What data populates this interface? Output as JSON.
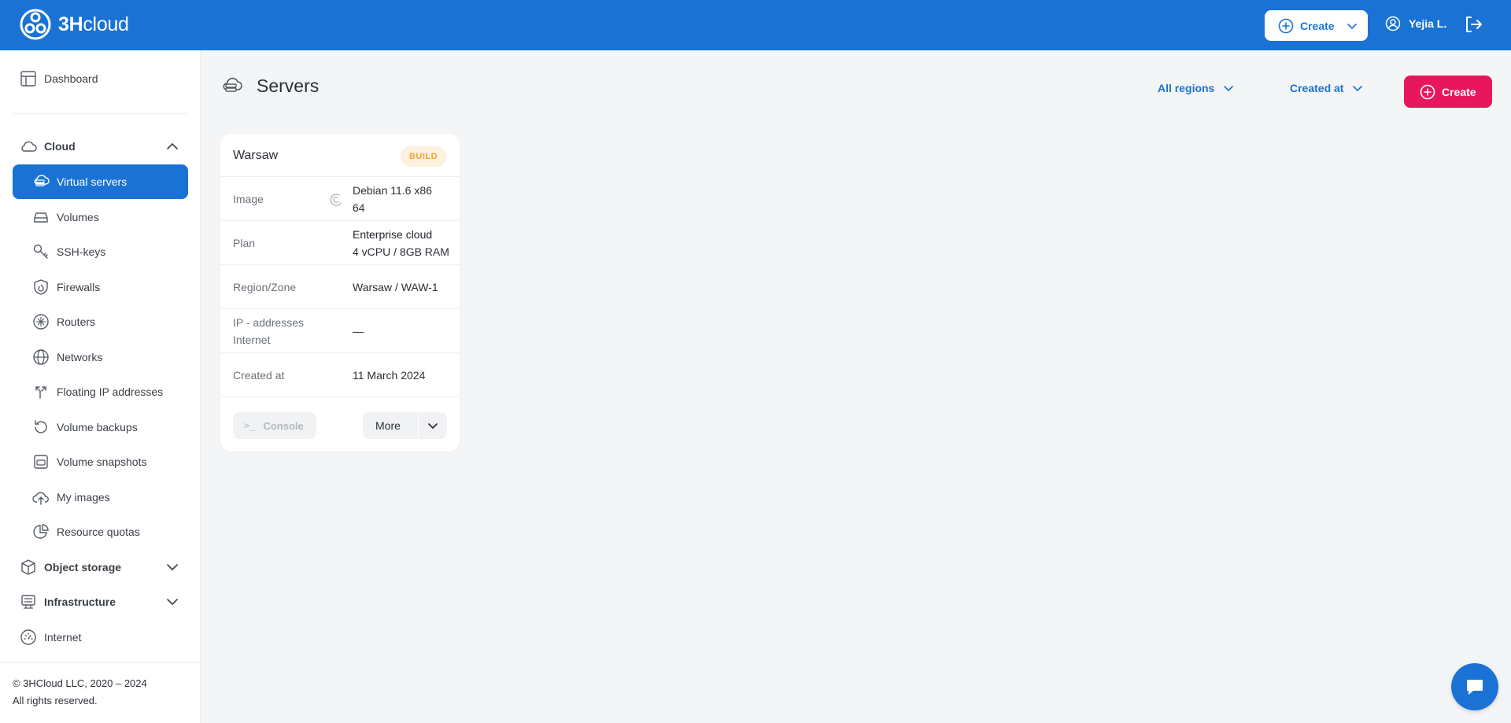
{
  "header": {
    "logo_bold": "3H",
    "logo_rest": "cloud",
    "create_label": "Create",
    "user_name": "Yejia L."
  },
  "sidebar": {
    "dashboard": "Dashboard",
    "cloud": "Cloud",
    "cloud_items": [
      {
        "label": "Virtual servers",
        "icon": "servers-icon"
      },
      {
        "label": "Volumes",
        "icon": "volume-icon"
      },
      {
        "label": "SSH-keys",
        "icon": "key-icon"
      },
      {
        "label": "Firewalls",
        "icon": "firewall-icon"
      },
      {
        "label": "Routers",
        "icon": "router-icon"
      },
      {
        "label": "Networks",
        "icon": "globe-icon"
      },
      {
        "label": "Floating IP addresses",
        "icon": "floating-ip-icon"
      },
      {
        "label": "Volume backups",
        "icon": "backup-icon"
      },
      {
        "label": "Volume snapshots",
        "icon": "snapshot-icon"
      },
      {
        "label": "My images",
        "icon": "upload-icon"
      },
      {
        "label": "Resource quotas",
        "icon": "pie-icon"
      }
    ],
    "object_storage": "Object storage",
    "infrastructure": "Infrastructure",
    "internet": "Internet",
    "footer_line1": "© 3HCloud LLC, 2020 – 2024",
    "footer_line2": "All rights reserved."
  },
  "main": {
    "title": "Servers",
    "filter_regions": "All regions",
    "filter_sort": "Created at",
    "create_label": "Create"
  },
  "server_card": {
    "name": "Warsaw",
    "status": "BUILD",
    "rows": {
      "image_label": "Image",
      "image_value_line1": "Debian 11.6 x86",
      "image_value_line2": "64",
      "plan_label": "Plan",
      "plan_value_line1": "Enterprise cloud",
      "plan_value_line2": "4 vCPU / 8GB RAM",
      "region_label": "Region/Zone",
      "region_value": "Warsaw / WAW-1",
      "ip_label_line1": "IP - addresses",
      "ip_label_line2": "Internet",
      "ip_value": "—",
      "created_label": "Created at",
      "created_value": "11 March 2024"
    },
    "console_label": "Console",
    "more_label": "More"
  },
  "colors": {
    "primary": "#1a73d4",
    "accent": "#e8175d",
    "badge_bg": "#fdf0dc",
    "badge_text": "#f0a33a"
  }
}
